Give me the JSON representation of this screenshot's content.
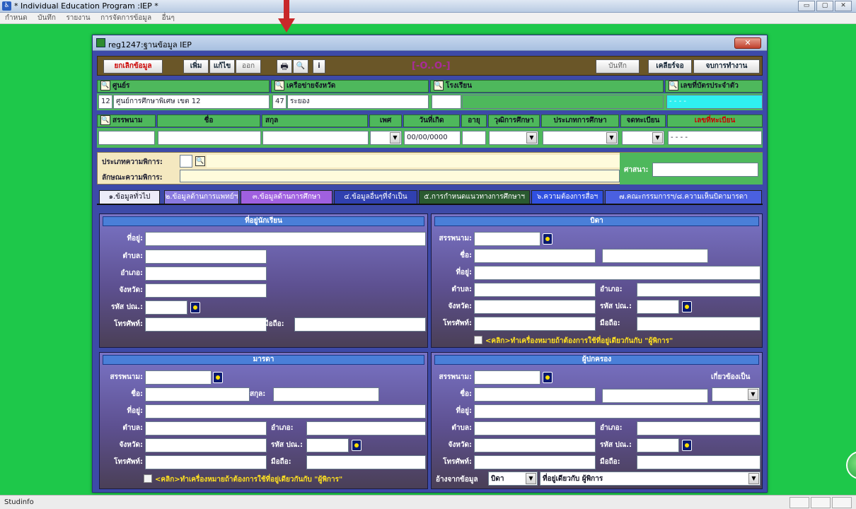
{
  "window": {
    "title": "* Individual Education Program :IEP *",
    "controls": [
      "▭",
      "▢",
      "✕"
    ]
  },
  "menu": [
    "กำหนด",
    "บันทึก",
    "รายงาน",
    "การจัดการข้อมูล",
    "อื่นๆ"
  ],
  "status": {
    "text": "Studinfo"
  },
  "dialog": {
    "title": "reg1247:ฐานข้อมูล IEP",
    "close": "✕"
  },
  "toolbar": {
    "cancel": "ยกเลิกข้อมูล",
    "add": "เพิ่ม",
    "edit": "แก้ไข",
    "exit": "ออก",
    "print": "🖶",
    "search": "🔍",
    "info": "i",
    "mode": "[-O..O-]",
    "save": "บันทึก",
    "clear": "เคลียร์จอ",
    "finish": "จบการทำงาน"
  },
  "colors": {
    "accent_green": "#4eb85c",
    "dialog_bg": "#3d4aa8",
    "toolbar": "#6a5628",
    "highlight_cyan": "#2ff0f0"
  },
  "row1": {
    "h_center": "ศูนย์ร",
    "h_network": "เครือข่ายจังหวัด",
    "h_school": "โรงเรียน",
    "h_idcard": "เลขที่บัตรประจำตัว",
    "center_code": "12",
    "center_name": "ศูนย์การศึกษาพิเศษ เขต 12",
    "network_code": "47",
    "network_name": "ระยอง",
    "idcard": "- - - -"
  },
  "row2": {
    "h_prefix": "สรรพนาม",
    "h_name": "ชื่อ",
    "h_surname": "สกุล",
    "h_sex": "เพศ",
    "h_birth": "วันที่เกิด",
    "h_age": "อายุ",
    "h_edu_level": "วุฒิการศึกษา",
    "h_edu_type": "ประเภทการศึกษา",
    "h_reg": "จดทะเบียน",
    "h_regno": "เลขที่ทะเบียน",
    "birth": "00/00/0000",
    "regno": "- - - -"
  },
  "disability": {
    "type_label": "ประเภทความพิการ:",
    "char_label": "ลักษณะความพิการ:",
    "religion_label": "ศาสนา:"
  },
  "tabs": [
    "๑.ข้อมูลทั่วไป",
    "๒.ข้อมูลด้านการแพทย์ฯ",
    "๓.ข้อมูลด้านการศึกษา",
    "๔.ข้อมูลอื่นๆที่จำเป็น",
    "๕.การกำหนดแนวทางการศึกษาฯ",
    "๖.ความต้องการสื่อฯ",
    "๗.คณะกรรมการฯ/๘.ความเห็นบิดามารดา"
  ],
  "tab_colors": [
    "#e8e8f8",
    "#8a7ae0",
    "#a060e0",
    "#3040b0",
    "#2a5a30",
    "#3050e0",
    "#4a60e0"
  ],
  "student_address": {
    "head": "ที่อยู่นักเรียน",
    "address": "ที่อยู่:",
    "subdistrict": "ตำบล:",
    "district": "อำเภอ:",
    "province": "จังหวัด:",
    "postcode": "รหัส ปณ.:",
    "phone": "โทรศัพท์:",
    "mobile": "มือถือ:"
  },
  "father": {
    "head": "บิดา",
    "prefix": "สรรพนาม:",
    "name": "ชื่อ:",
    "surname": "สกุล:",
    "address": "ที่อยู่:",
    "subdistrict": "ตำบล:",
    "district": "อำเภอ:",
    "province": "จังหวัด:",
    "postcode": "รหัส ปณ.:",
    "phone": "โทรศัพท์:",
    "mobile": "มือถือ:",
    "same_addr": "<คลิก>ทำเครื่องหมายถ้าต้องการใช้ที่อยู่เดียวกันกับ \"ผู้พิการ\""
  },
  "mother": {
    "head": "มารดา",
    "prefix": "สรรพนาม:",
    "name": "ชื่อ:",
    "surname": "สกุล:",
    "address": "ที่อยู่:",
    "subdistrict": "ตำบล:",
    "district": "อำเภอ:",
    "province": "จังหวัด:",
    "postcode": "รหัส ปณ.:",
    "phone": "โทรศัพท์:",
    "mobile": "มือถือ:",
    "same_addr": "<คลิก>ทำเครื่องหมายถ้าต้องการใช้ที่อยู่เดียวกันกับ \"ผู้พิการ\""
  },
  "guardian": {
    "head": "ผู้ปกครอง",
    "prefix": "สรรพนาม:",
    "relation": "เกี่ยวข้องเป็น",
    "name": "ชื่อ:",
    "surname": "สกุล:",
    "address": "ที่อยู่:",
    "subdistrict": "ตำบล:",
    "district": "อำเภอ:",
    "province": "จังหวัด:",
    "postcode": "รหัส ปณ.:",
    "phone": "โทรศัพท์:",
    "mobile": "มือถือ:",
    "ref_label": "อ้างจากข้อมูล",
    "ref_value": "บิดา",
    "same_value": "ที่อยู่เดียวกับ ผู้พิการ"
  }
}
